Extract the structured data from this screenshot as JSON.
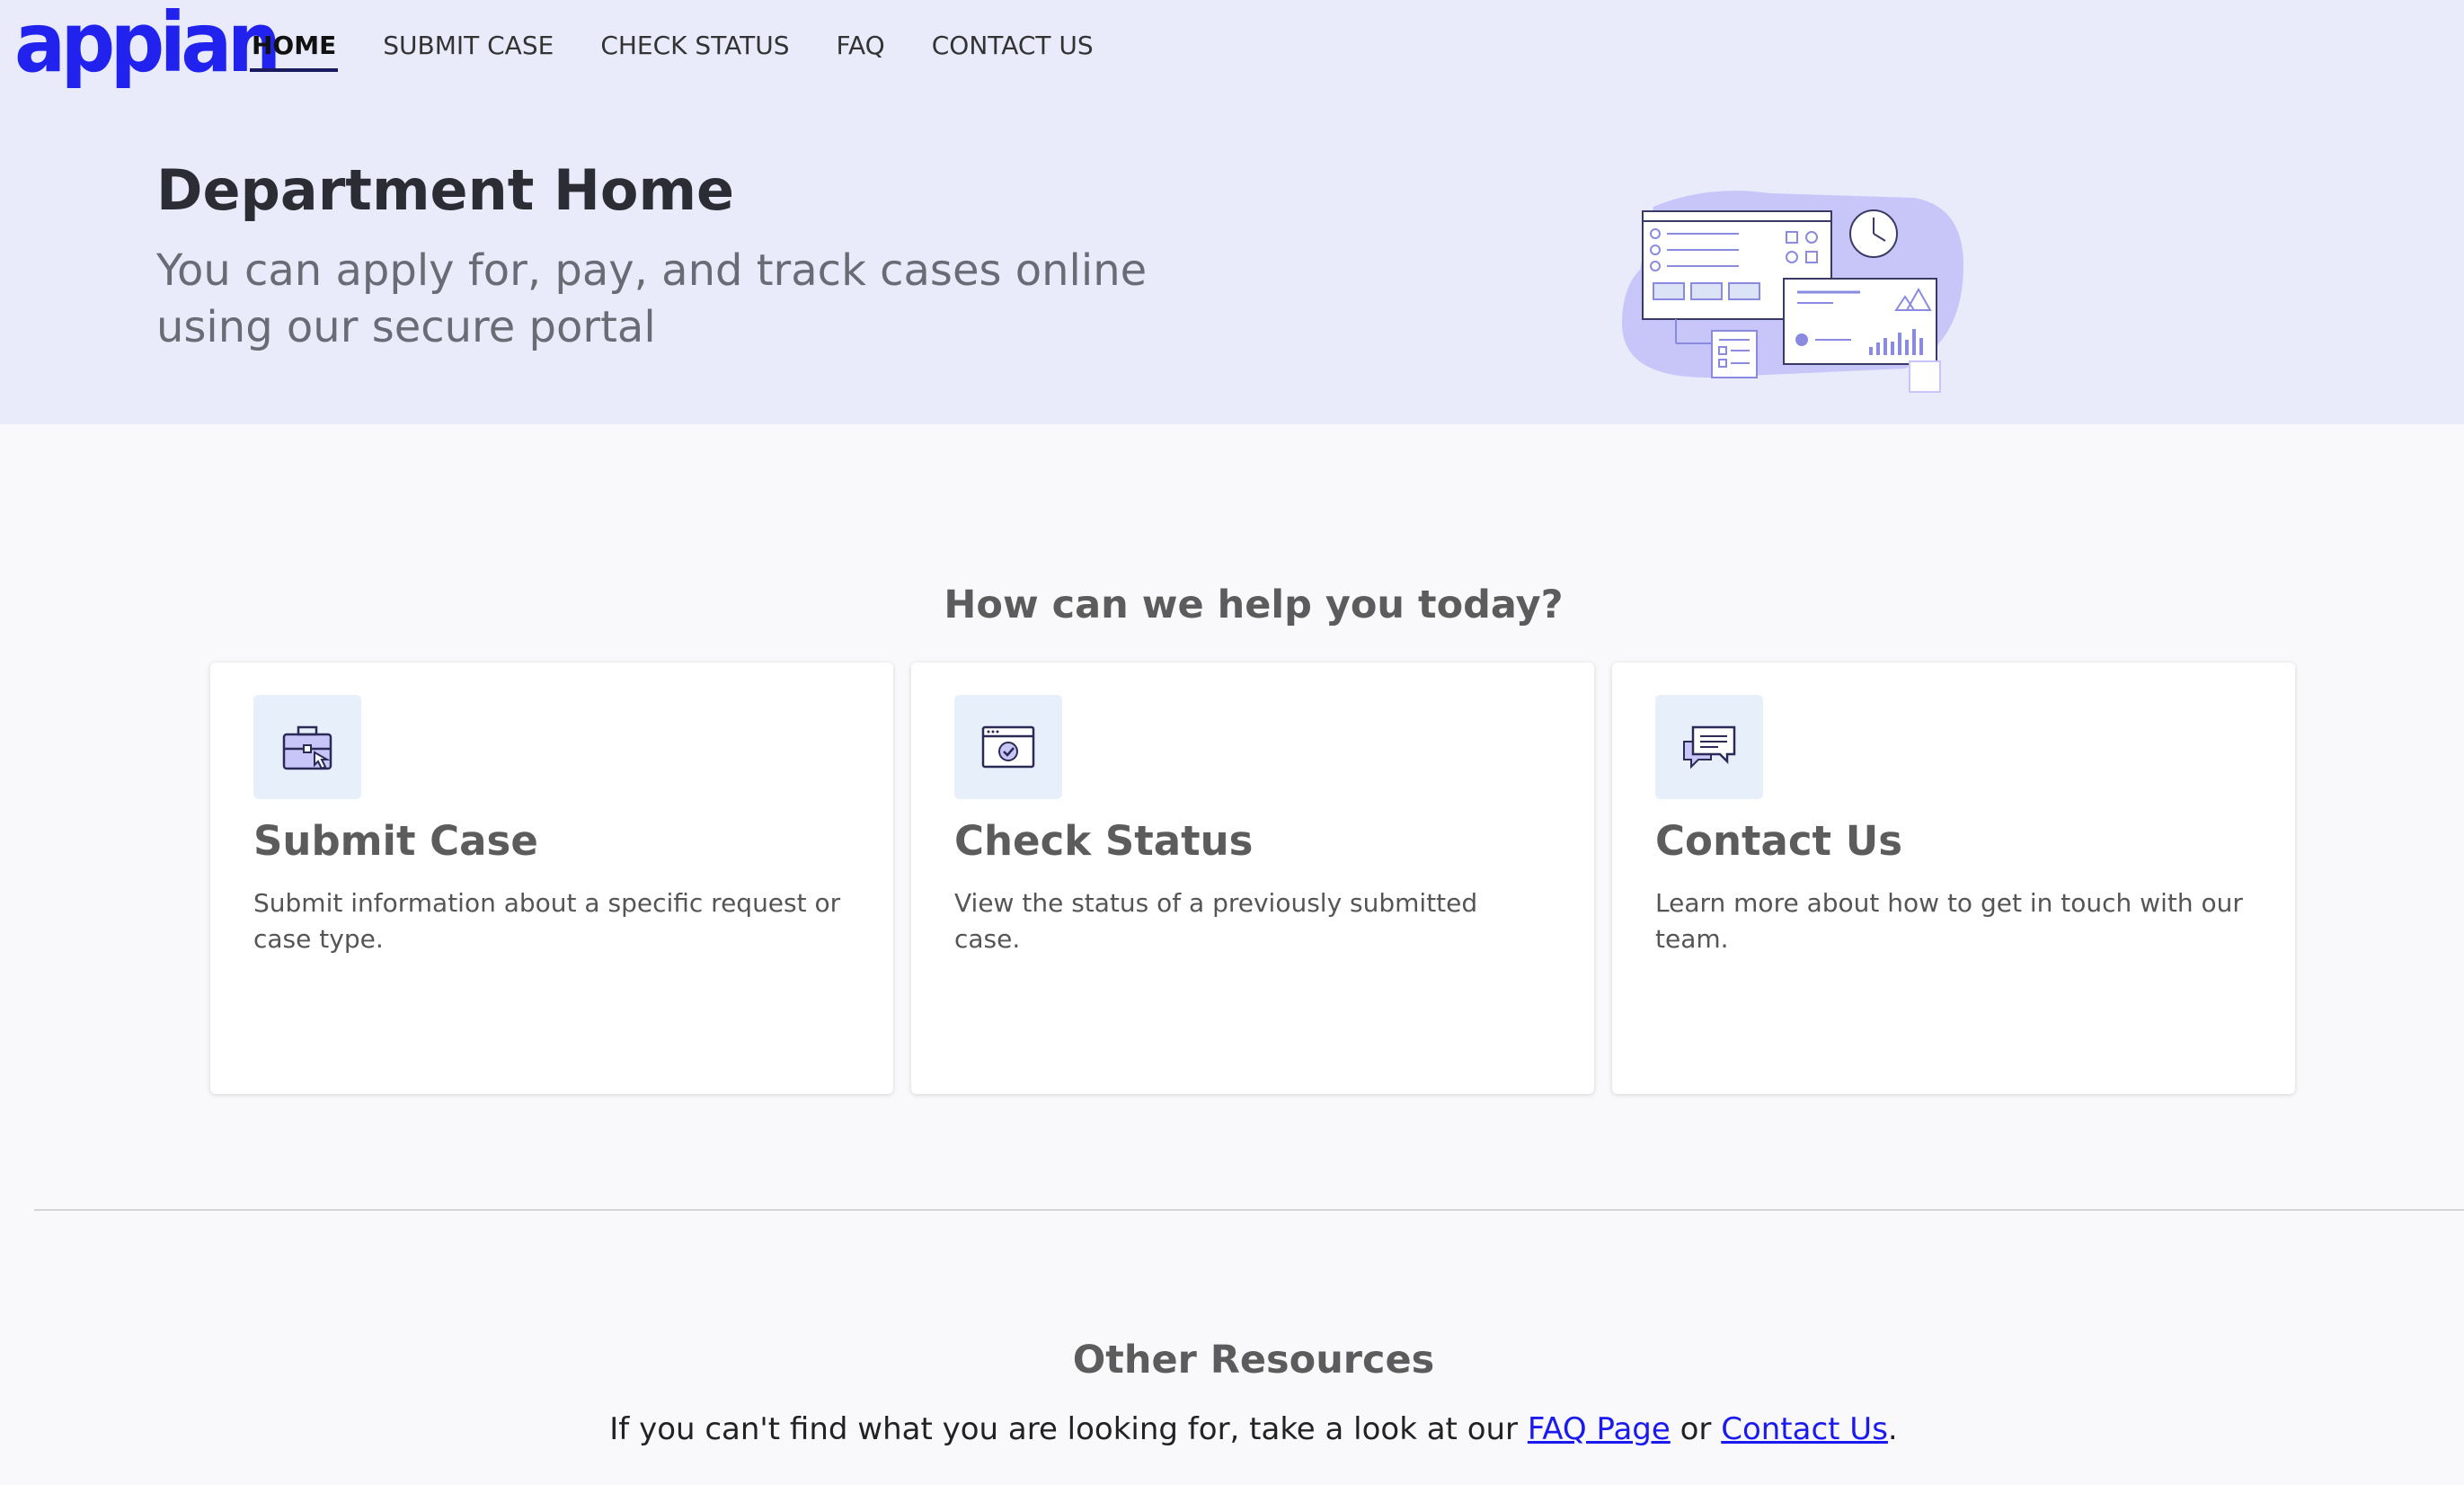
{
  "app": {
    "logo_text": "appian",
    "brand_color": "#2222ee"
  },
  "nav": {
    "items": [
      {
        "label": "HOME",
        "active": true
      },
      {
        "label": "SUBMIT CASE"
      },
      {
        "label": "CHECK STATUS"
      },
      {
        "label": "FAQ"
      },
      {
        "label": "CONTACT US"
      }
    ]
  },
  "hero": {
    "title": "Department Home",
    "subtitle": "You can apply for, pay, and track cases online using our secure portal",
    "illustration_icon": "dashboard-illustration"
  },
  "help": {
    "heading": "How can we help you today?",
    "cards": [
      {
        "icon": "briefcase-icon",
        "title": "Submit Case",
        "description": "Submit information about a specific request or case type."
      },
      {
        "icon": "check-window-icon",
        "title": "Check Status",
        "description": "View the status of a previously submitted case."
      },
      {
        "icon": "chat-bubbles-icon",
        "title": "Contact Us",
        "description": "Learn more about how to get in touch with our team."
      }
    ]
  },
  "resources": {
    "heading": "Other Resources",
    "text_before": "If you can't find what you are looking for, take a look at our ",
    "faq_link": "FAQ Page",
    "text_middle": " or ",
    "contact_link": "Contact Us",
    "text_after": "."
  }
}
